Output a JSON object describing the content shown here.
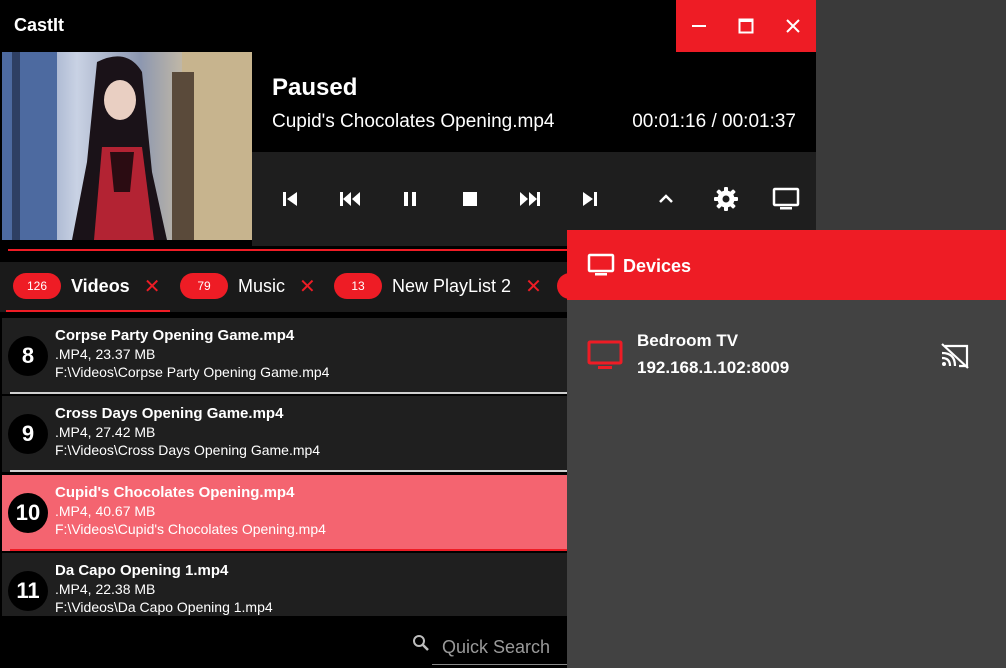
{
  "app": {
    "title": "CastIt"
  },
  "window_controls": {
    "minimize_icon": "minimize-icon",
    "maximize_icon": "maximize-icon",
    "close_icon": "close-icon"
  },
  "player": {
    "status": "Paused",
    "file": "Cupid's Chocolates Opening.mp4",
    "time": "00:01:16 / 00:01:37",
    "controls": [
      "skip-previous-icon",
      "rewind-icon",
      "pause-icon",
      "stop-icon",
      "fast-forward-icon",
      "skip-next-icon",
      "chevron-up-icon",
      "settings-icon",
      "monitor-icon"
    ]
  },
  "tabs": [
    {
      "count": "126",
      "label": "Videos",
      "close": "✕"
    },
    {
      "count": "79",
      "label": "Music",
      "close": "✕"
    },
    {
      "count": "13",
      "label": "New PlayList 2",
      "close": "✕"
    }
  ],
  "items": [
    {
      "num": "8",
      "name": "Corpse Party Opening Game.mp4",
      "meta": ".MP4, 23.37 MB",
      "path": "F:\\Videos\\Corpse Party Opening Game.mp4"
    },
    {
      "num": "9",
      "name": "Cross Days Opening Game.mp4",
      "meta": ".MP4, 27.42 MB",
      "path": "F:\\Videos\\Cross Days Opening Game.mp4"
    },
    {
      "num": "10",
      "name": "Cupid's Chocolates Opening.mp4",
      "meta": ".MP4, 40.67 MB",
      "path": "F:\\Videos\\Cupid's Chocolates Opening.mp4",
      "selected": true
    },
    {
      "num": "11",
      "name": "Da Capo Opening 1.mp4",
      "meta": ".MP4, 22.38 MB",
      "path": "F:\\Videos\\Da Capo Opening 1.mp4"
    }
  ],
  "search": {
    "placeholder": "Quick Search",
    "icon": "search-icon"
  },
  "devices": {
    "title": "Devices",
    "list": [
      {
        "name": "Bedroom TV",
        "address": "192.168.1.102:8009",
        "icon": "tv-icon",
        "action_icon": "cast-icon"
      }
    ]
  },
  "colors": {
    "accent": "#ee1c25",
    "selected_row": "#f46470",
    "panel": "#424242"
  }
}
